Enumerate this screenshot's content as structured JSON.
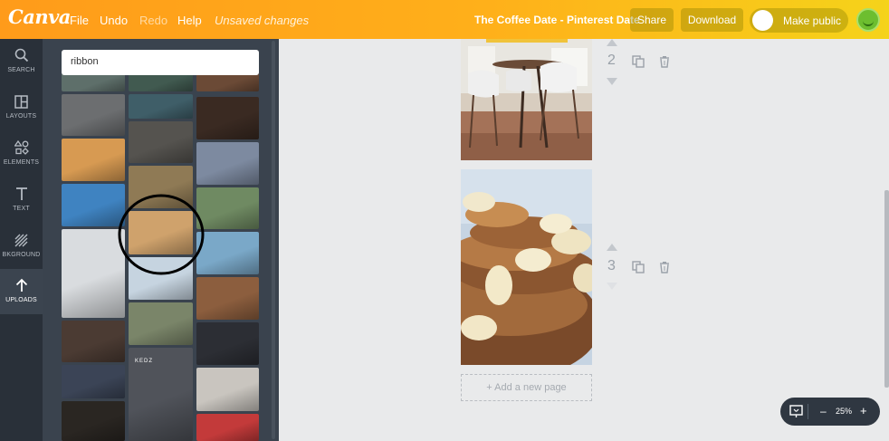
{
  "topbar": {
    "logo": "Canva",
    "menu": {
      "file": "File",
      "undo": "Undo",
      "redo": "Redo",
      "help": "Help"
    },
    "status": "Unsaved changes",
    "doc_title": "The Coffee Date - Pinterest Date",
    "share_label": "Share",
    "download_label": "Download",
    "make_public_label": "Make public"
  },
  "leftnav": {
    "items": [
      {
        "label": "SEARCH",
        "icon": "search-icon"
      },
      {
        "label": "LAYOUTS",
        "icon": "layouts-icon"
      },
      {
        "label": "ELEMENTS",
        "icon": "elements-icon"
      },
      {
        "label": "TEXT",
        "icon": "text-icon"
      },
      {
        "label": "BKGROUND",
        "icon": "background-icon"
      },
      {
        "label": "UPLOADS",
        "icon": "upload-icon"
      }
    ]
  },
  "search": {
    "query": "ribbon"
  },
  "thumbnails": [
    {
      "subject": "toys on desk",
      "color": "#5e6f6a"
    },
    {
      "subject": "laptop and coffee",
      "color": "#415a50"
    },
    {
      "subject": "wood grain",
      "color": "#6b4a36"
    },
    {
      "subject": "duck on desk",
      "color": "#6c6e70"
    },
    {
      "subject": "cards on table",
      "color": "#3f5e68"
    },
    {
      "subject": "coffee cup",
      "color": "#3a2a22"
    },
    {
      "subject": "salmon plate",
      "color": "#d79a52"
    },
    {
      "subject": "chess pieces",
      "color": "#55534f"
    },
    {
      "subject": "magazines",
      "color": "#7d8aa0"
    },
    {
      "subject": "color swatches",
      "color": "#3f83c1"
    },
    {
      "subject": "pencils",
      "color": "#8f7a55"
    },
    {
      "subject": "money",
      "color": "#6f8a62"
    },
    {
      "subject": "pancakes with banana",
      "color": "#cfa26c"
    },
    {
      "subject": "phone on desk",
      "color": "#7aa8c8"
    },
    {
      "subject": "eggs",
      "color": "#d9dcdf"
    },
    {
      "subject": "white figure",
      "color": "#c6d4e0"
    },
    {
      "subject": "food tray",
      "color": "#8c5e3e"
    },
    {
      "subject": "parade",
      "color": "#7a8569"
    },
    {
      "subject": "mixing desk",
      "color": "#4b3b33"
    },
    {
      "subject": "ballerina",
      "color": "#2c2e34"
    },
    {
      "subject": "stage lights",
      "color": "#3b4456"
    },
    {
      "subject": "runway",
      "color": "#50535a",
      "label": "KEDZ"
    },
    {
      "subject": "white dinner",
      "color": "#c9c5bf"
    },
    {
      "subject": "concert crowd",
      "color": "#2a2622"
    },
    {
      "subject": "car",
      "color": "#c33a3a"
    }
  ],
  "canvas": {
    "pages": [
      {
        "number": "2",
        "subject": "cafe chairs"
      },
      {
        "number": "3",
        "subject": "banana pancakes"
      }
    ],
    "add_page_label": "+ Add a new page"
  },
  "zoom": {
    "level": "25%",
    "minus": "–",
    "plus": "+"
  },
  "colors": {
    "topbar_start": "#ff9b1a",
    "topbar_end": "#f5d31a",
    "leftnav": "#293039",
    "panel": "#3a434e",
    "canvas_bg": "#e9eaeb"
  }
}
